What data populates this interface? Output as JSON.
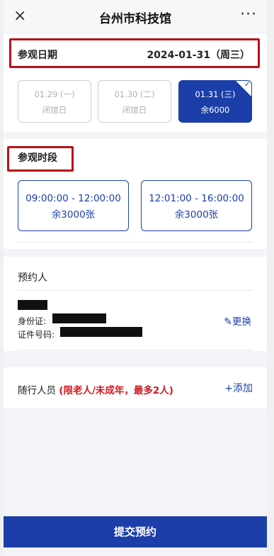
{
  "header": {
    "title": "台州市科技馆",
    "close_icon": "×",
    "more_icon": "···"
  },
  "visit_date": {
    "label": "参观日期",
    "value": "2024-01-31（周三）",
    "options": [
      {
        "date": "01.29 (一)",
        "status": "闭馆日",
        "selected": false
      },
      {
        "date": "01.30 (二)",
        "status": "闭馆日",
        "selected": false
      },
      {
        "date": "01.31 (三)",
        "status": "余6000",
        "selected": true
      }
    ]
  },
  "time_slot": {
    "label": "参观时段",
    "slots": [
      {
        "time": "09:00:00 - 12:00:00",
        "remaining": "余3000张"
      },
      {
        "time": "12:01:00 - 16:00:00",
        "remaining": "余3000张"
      }
    ]
  },
  "booker": {
    "title": "预约人",
    "id_label": "身份证:",
    "doc_label": "证件号码:",
    "edit_label": "更换"
  },
  "companions": {
    "label": "随行人员",
    "note": "(限老人/未成年，最多2人)",
    "add_label": "+添加"
  },
  "submit_label": "提交预约",
  "colors": {
    "primary": "#1b3ea9",
    "highlight": "#b6111a",
    "warning": "#d0191e"
  }
}
